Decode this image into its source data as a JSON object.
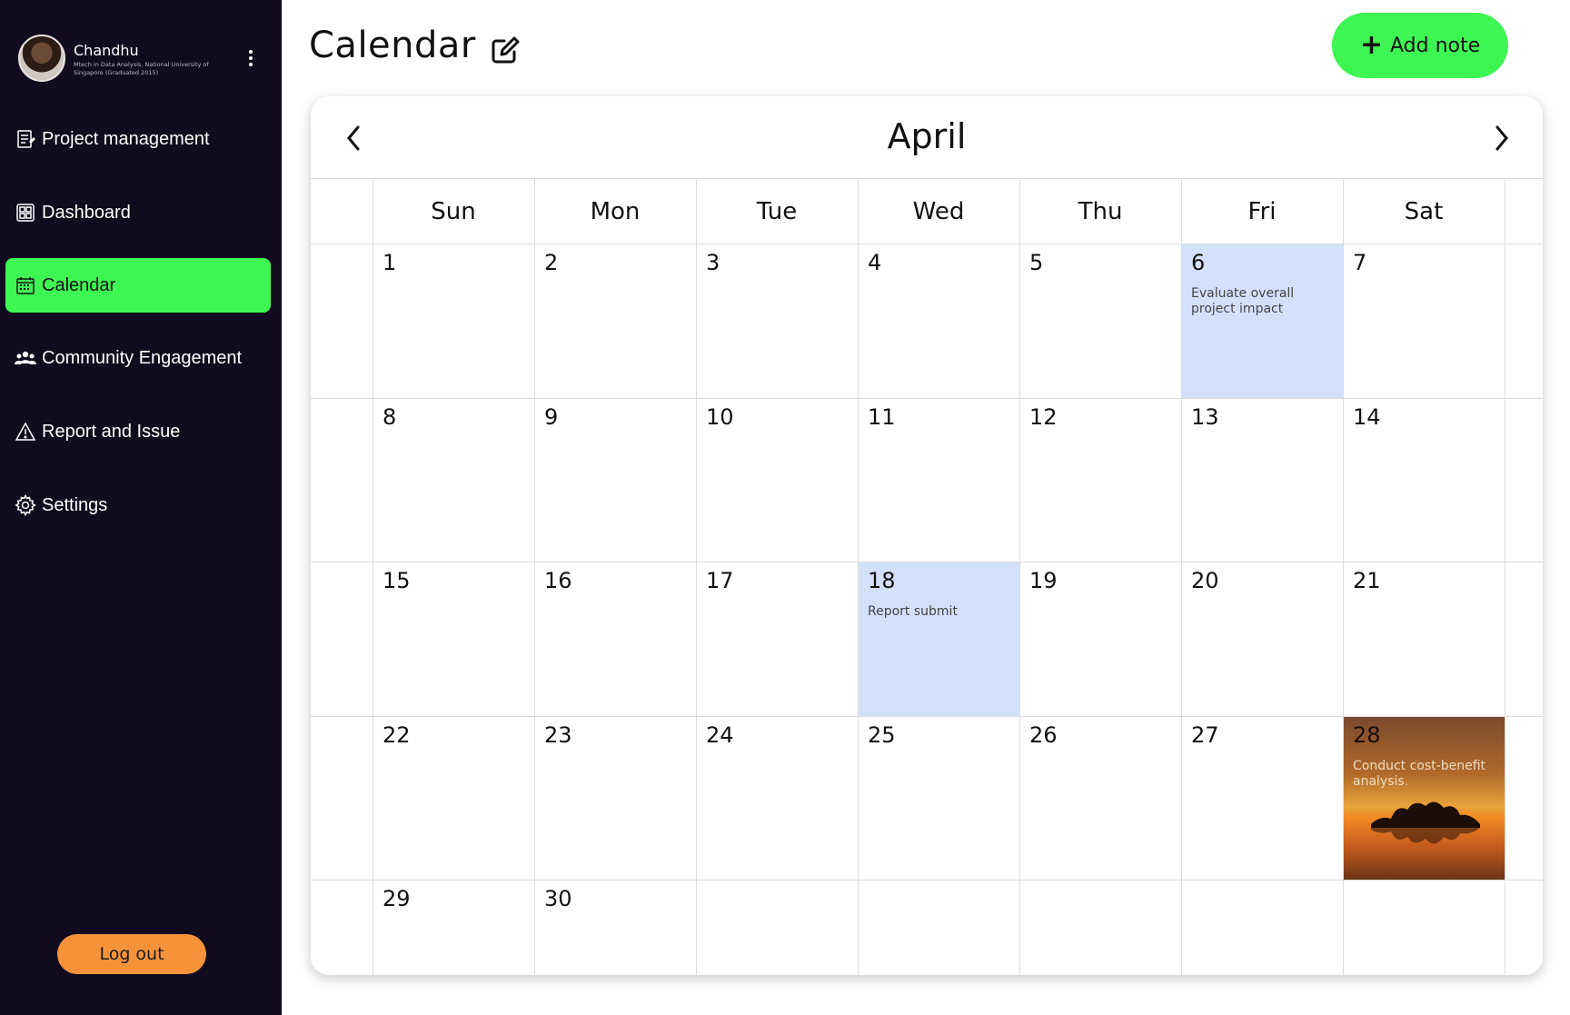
{
  "sidebar": {
    "profile": {
      "name": "Chandhu",
      "subtitle": "Mtech in Data Analysis, National University of Singapore (Graduated 2015)"
    },
    "items": [
      {
        "label": "Project management",
        "icon": "document-icon"
      },
      {
        "label": "Dashboard",
        "icon": "dashboard-icon"
      },
      {
        "label": "Calendar",
        "icon": "calendar-icon",
        "active": true
      },
      {
        "label": "Community Engagement",
        "icon": "people-icon"
      },
      {
        "label": "Report and Issue",
        "icon": "warning-icon"
      },
      {
        "label": "Settings",
        "icon": "gear-icon"
      }
    ],
    "logout_label": "Log out"
  },
  "header": {
    "title": "Calendar",
    "add_note_label": "Add note"
  },
  "calendar": {
    "month": "April",
    "weekdays": [
      "Sun",
      "Mon",
      "Tue",
      "Wed",
      "Thu",
      "Fri",
      "Sat"
    ],
    "events": {
      "6": "Evaluate overall project impact",
      "18": "Report submit",
      "28": "Conduct cost-benefit analysis."
    }
  },
  "colors": {
    "sidebar_bg": "#100b1f",
    "accent_green": "#3ef653",
    "logout_orange": "#f6933a",
    "event_highlight": "#d3e0fa"
  }
}
